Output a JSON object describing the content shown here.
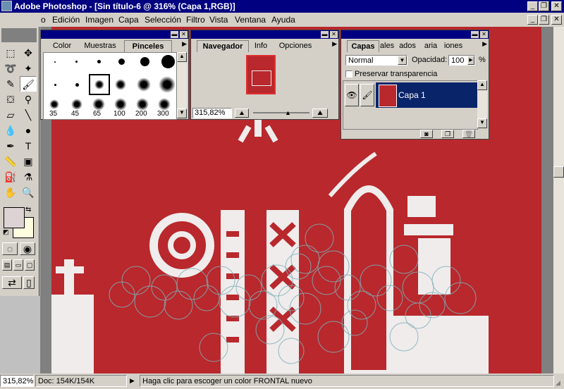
{
  "window": {
    "title": "Adobe Photoshop - [Sin título-6 @ 316% (Capa 1,RGB)]"
  },
  "menu": {
    "items": [
      "o",
      "Edición",
      "Imagen",
      "Capa",
      "Selección",
      "Filtro",
      "Vista",
      "Ventana",
      "Ayuda"
    ]
  },
  "brushes_palette": {
    "tabs": [
      "Color",
      "Muestras",
      "Pinceles"
    ],
    "active_tab": "Pinceles",
    "brush_sizes": [
      "35",
      "45",
      "65",
      "100",
      "200",
      "300"
    ]
  },
  "navigator_palette": {
    "tabs": [
      "Navegador",
      "Info",
      "Opciones"
    ],
    "active_tab": "Navegador",
    "zoom": "315,82%"
  },
  "layers_palette": {
    "tabs": [
      "Capas",
      "ales",
      "ados",
      "aria",
      "iones"
    ],
    "active_tab": "Capas",
    "blend_mode": "Normal",
    "opacity_label": "Opacidad:",
    "opacity_value": "100",
    "opacity_unit": "%",
    "preserve_label": "Preservar transparencia",
    "layers": [
      {
        "name": "Capa 1"
      }
    ]
  },
  "status": {
    "zoom": "315,82%",
    "doc": "Doc: 154K/154K",
    "hint": "Haga clic para escoger un color FRONTAL nuevo"
  },
  "colors": {
    "title_bar": "#000080",
    "canvas_red": "#b8282c",
    "foreground": "#ddd2d4",
    "background": "#fffde0"
  }
}
